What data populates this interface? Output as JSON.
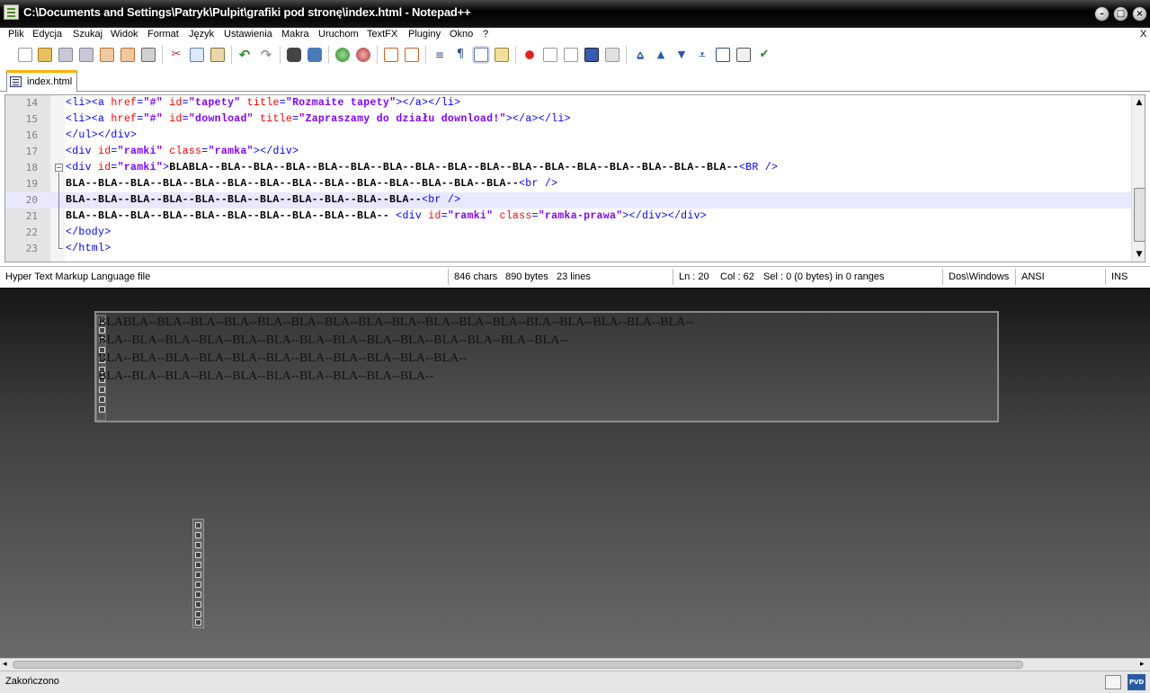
{
  "window": {
    "title": "C:\\Documents and Settings\\Patryk\\Pulpit\\grafiki pod stronę\\index.html - Notepad++",
    "minimize_glyph": "–",
    "maximize_glyph": "□",
    "close_glyph": "×"
  },
  "menu": {
    "items": [
      "Plik",
      "Edycja",
      "Szukaj",
      "Widok",
      "Format",
      "Język",
      "Ustawienia",
      "Makra",
      "Uruchom",
      "TextFX",
      "Pluginy",
      "Okno",
      "?"
    ],
    "close_doc": "X"
  },
  "toolbar": {
    "icons": [
      "new-file-icon",
      "open-file-icon",
      "save-icon",
      "save-all-icon",
      "close-icon",
      "close-all-icon",
      "print-icon",
      "cut-icon",
      "copy-icon",
      "paste-icon",
      "undo-icon",
      "redo-icon",
      "find-icon",
      "replace-icon",
      "zoom-in-icon",
      "zoom-out-icon",
      "sync-v-icon",
      "sync-h-icon",
      "word-wrap-icon",
      "show-all-chars-icon",
      "indent-guide-icon",
      "doc-map-icon",
      "record-macro-icon",
      "stop-record-icon",
      "play-macro-icon",
      "run-macro-multiple-icon",
      "save-macro-icon",
      "trim-icon",
      "move-up-icon",
      "move-down-icon",
      "blank-icon",
      "console-icon",
      "print-preview-icon",
      "spellcheck-icon"
    ]
  },
  "tabs": [
    {
      "label": "index.html"
    }
  ],
  "editor": {
    "lines": [
      {
        "num": "14",
        "code": "<li><a href=\"#\" id=\"tapety\" title=\"Rozmaite tapety\"></a></li>"
      },
      {
        "num": "15",
        "code": "<li><a href=\"#\" id=\"download\" title=\"Zapraszamy do działu download!\"></a></li>"
      },
      {
        "num": "16",
        "code": "</ul></div>"
      },
      {
        "num": "17",
        "code": "<div id=\"ramki\" class=\"ramka\"></div>"
      },
      {
        "num": "18",
        "code": "<div id=\"ramki\">BLABLA--BLA--BLA--BLA--BLA--BLA--BLA--BLA--BLA--BLA--BLA--BLA--BLA--BLA--BLA--BLA--BLA--<BR />"
      },
      {
        "num": "19",
        "code": "BLA--BLA--BLA--BLA--BLA--BLA--BLA--BLA--BLA--BLA--BLA--BLA--BLA--BLA--<br />"
      },
      {
        "num": "20",
        "code": "BLA--BLA--BLA--BLA--BLA--BLA--BLA--BLA--BLA--BLA--BLA--<br />"
      },
      {
        "num": "21",
        "code": "BLA--BLA--BLA--BLA--BLA--BLA--BLA--BLA--BLA--BLA-- <div id=\"ramki\" class=\"ramka-prawa\"></div></div>"
      },
      {
        "num": "22",
        "code": "</body>"
      },
      {
        "num": "23",
        "code": "</html>"
      }
    ],
    "current_line": "20"
  },
  "status": {
    "file_type": "Hyper Text Markup Language file",
    "chars": "846 chars",
    "bytes": "890 bytes",
    "lines": "23 lines",
    "ln": "Ln : 20",
    "col": "Col : 62",
    "sel": "Sel : 0 (0 bytes) in 0 ranges",
    "eol": "Dos\\Windows",
    "encoding": "ANSI",
    "mode": "INS"
  },
  "preview": {
    "lines": [
      "BLABLA--BLA--BLA--BLA--BLA--BLA--BLA--BLA--BLA--BLA--BLA--BLA--BLA--BLA--BLA--BLA--BLA--",
      "BLA--BLA--BLA--BLA--BLA--BLA--BLA--BLA--BLA--BLA--BLA--BLA--BLA--BLA--",
      "BLA--BLA--BLA--BLA--BLA--BLA--BLA--BLA--BLA--BLA--BLA--",
      "BLA--BLA--BLA--BLA--BLA--BLA--BLA--BLA--BLA--BLA--"
    ]
  },
  "browser": {
    "status_text": "Zakończono",
    "pvd_label": "PVD",
    "scroll_left": "◂",
    "scroll_right": "▸",
    "scroll_up": "▲",
    "scroll_down": "▼"
  },
  "colors": {
    "tag": "#0000ff",
    "attribute": "#ff0000",
    "value": "#8000ff",
    "current_line": "#e8e8ff",
    "active_tab_accent": "#ffb000"
  }
}
